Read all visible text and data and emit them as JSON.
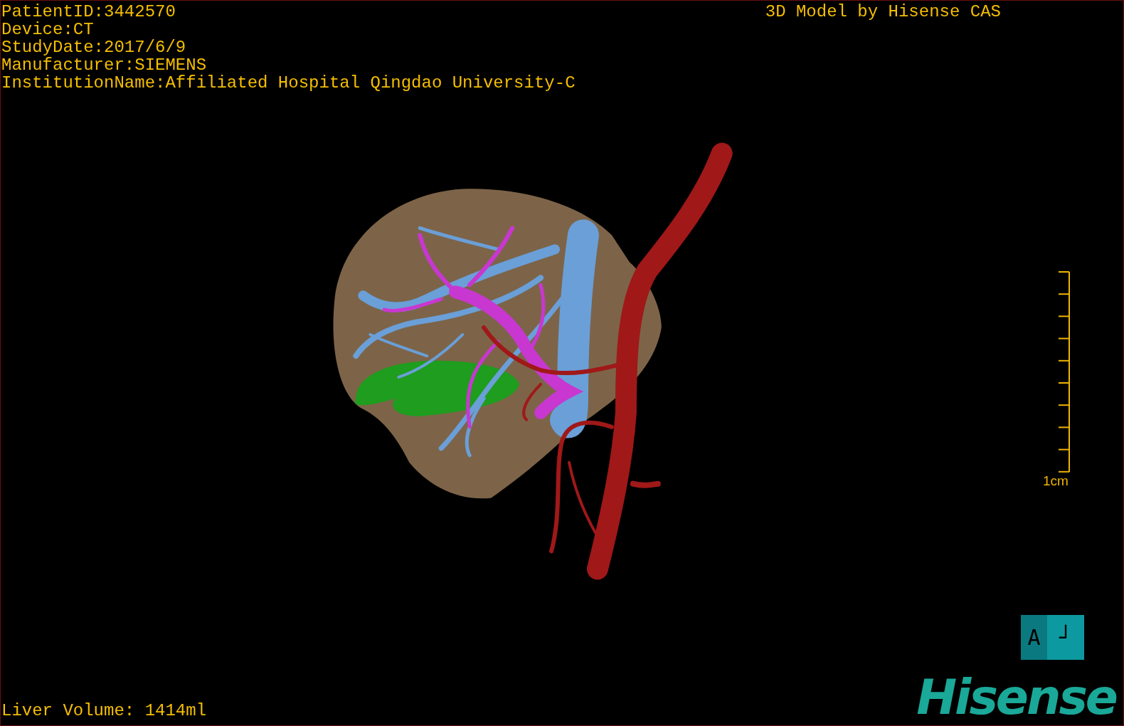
{
  "info_lines": [
    "PatientID:3442570",
    "Device:CT",
    "StudyDate:2017/6/9",
    "Manufacturer:SIEMENS",
    "InstitutionName:Affiliated Hospital Qingdao University-C"
  ],
  "title": "3D Model by Hisense CAS",
  "scale": {
    "label": "1cm"
  },
  "orientation_cube": {
    "faces": [
      "A",
      "┘"
    ]
  },
  "liver_volume": "Liver Volume: 1414ml",
  "logo": "Hisense"
}
